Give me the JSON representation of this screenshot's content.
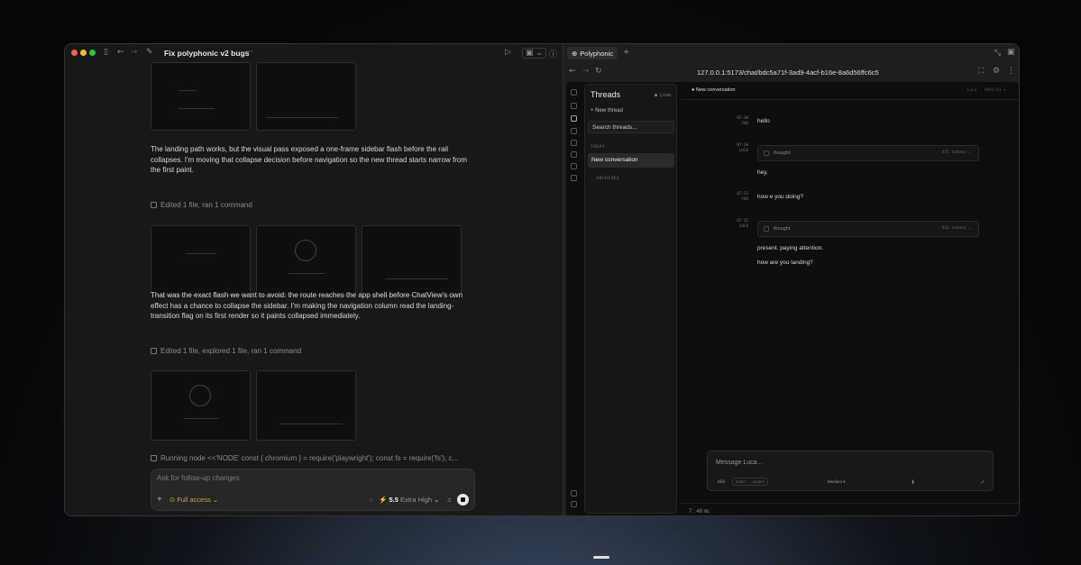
{
  "window": {
    "title": "Fix polyphonic v2 bugs",
    "traffic_colors": [
      "#fe5f57",
      "#febc2e",
      "#28c840"
    ]
  },
  "left": {
    "para1": "The landing path works, but the visual pass exposed a one-frame sidebar flash before the rail collapses. I'm moving that collapse decision before navigation so the new thread starts narrow from the first paint.",
    "meta1": "Edited 1 file, ran 1 command",
    "para2": "That was the exact flash we want to avoid: the route reaches the app shell before ChatView's own effect has a chance to collapse the sidebar. I'm making the navigation column read the landing-transition flag on its first render so it paints collapsed immediately.",
    "meta2": "Edited 1 file, explored 1 file, ran 1 command",
    "running": "Running node <<'NODE' const { chromium } = require('playwright'); const fs = require('fs'); c...",
    "composer": {
      "placeholder": "Ask for follow-up changes",
      "access": "Full access",
      "model_version": "5.5",
      "model_effort": "Extra High"
    }
  },
  "browser": {
    "tab_label": "Polyphonic",
    "url": "127.0.0.1:5173/chat/bdc5a71f-3ad9-4acf-b16e-8a6d56ffc6c5",
    "sidebar": {
      "title": "Threads",
      "live": "● Live",
      "new_thread": "+ New thread",
      "search": "Search threads...",
      "today": "TODAY",
      "item": "New conversation",
      "archives": "› ARCHIVES"
    },
    "chat": {
      "header_title": "● New conversation",
      "header_right": "Luca · 4091-01 ▾",
      "messages": [
        {
          "time": "07:38",
          "who": "YOU",
          "text": "hello"
        },
        {
          "time": "07:38",
          "who": "LUCA",
          "thought": "thought",
          "tokens": "475 tokens ⌄",
          "text": "hey."
        },
        {
          "time": "07:22",
          "who": "YOU",
          "text": "how e you doing?"
        },
        {
          "time": "07:22",
          "who": "LUCA",
          "thought": "thought",
          "tokens": "433 tokens ⌄",
          "text": "present. paying attention.",
          "text2": "how are you landing?"
        }
      ],
      "input_placeholder": "Message Luca...",
      "input_badge": "NEW",
      "input_pill": "GUEST · 10/897",
      "input_effort": "Medium ▾",
      "status_time": "7 : 48 ㎳"
    }
  }
}
